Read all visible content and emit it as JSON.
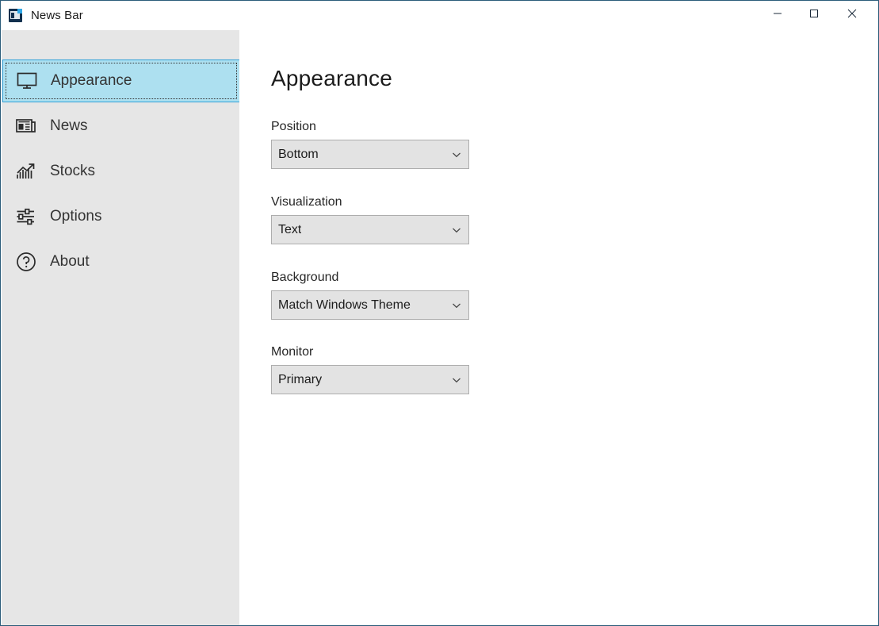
{
  "window": {
    "title": "News Bar",
    "app_icon": "news-bar-app-icon",
    "controls": {
      "minimize": "minimize-icon",
      "maximize": "maximize-icon",
      "close": "close-icon"
    }
  },
  "sidebar": {
    "items": [
      {
        "label": "Appearance",
        "icon": "monitor-icon",
        "selected": true
      },
      {
        "label": "News",
        "icon": "newspaper-icon",
        "selected": false
      },
      {
        "label": "Stocks",
        "icon": "chart-up-icon",
        "selected": false
      },
      {
        "label": "Options",
        "icon": "sliders-icon",
        "selected": false
      },
      {
        "label": "About",
        "icon": "question-circle-icon",
        "selected": false
      }
    ]
  },
  "main": {
    "heading": "Appearance",
    "fields": [
      {
        "label": "Position",
        "value": "Bottom"
      },
      {
        "label": "Visualization",
        "value": "Text"
      },
      {
        "label": "Background",
        "value": "Match Windows Theme"
      },
      {
        "label": "Monitor",
        "value": "Primary"
      }
    ]
  },
  "colors": {
    "window_border": "#2b5c7a",
    "sidebar_bg": "#e6e6e6",
    "selected_item_bg": "#ade0f0",
    "selected_item_border": "#2fa0d8",
    "combo_bg": "#e3e3e3",
    "combo_border": "#adadad",
    "text": "#1b1b1b"
  }
}
